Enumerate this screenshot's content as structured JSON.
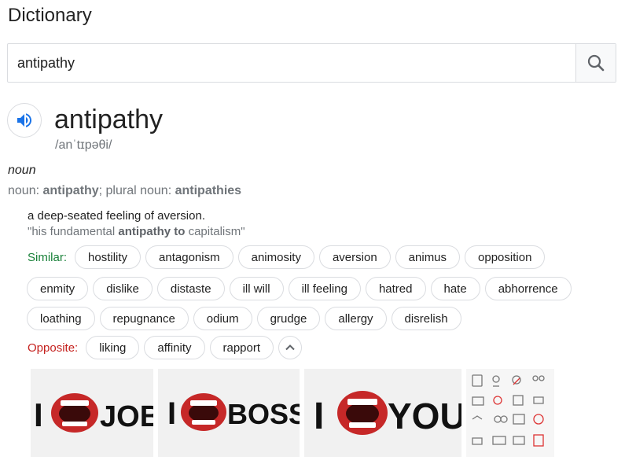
{
  "header": {
    "title": "Dictionary"
  },
  "search": {
    "value": "antipathy",
    "placeholder": ""
  },
  "entry": {
    "word": "antipathy",
    "phonetic": "/anˈtɪpəθi/",
    "part_of_speech": "noun",
    "forms": {
      "noun_label": "noun:",
      "noun": "antipathy",
      "separator": ";",
      "plural_label": "plural noun:",
      "plural": "antipathies"
    },
    "definition": "a deep-seated feeling of aversion.",
    "example": {
      "open": "\"his fundamental ",
      "highlight": "antipathy to",
      "close": " capitalism\""
    }
  },
  "similar": {
    "label": "Similar:",
    "words": [
      "hostility",
      "antagonism",
      "animosity",
      "aversion",
      "animus",
      "opposition",
      "enmity",
      "dislike",
      "distaste",
      "ill will",
      "ill feeling",
      "hatred",
      "hate",
      "abhorrence",
      "loathing",
      "repugnance",
      "odium",
      "grudge",
      "allergy",
      "disrelish"
    ]
  },
  "opposite": {
    "label": "Opposite:",
    "words": [
      "liking",
      "affinity",
      "rapport"
    ]
  },
  "images": [
    {
      "left": "I",
      "right": "JOB"
    },
    {
      "left": "I",
      "right": "BOSS"
    },
    {
      "left": "I",
      "right": "YOU"
    },
    {
      "icons": "antipathy icon set"
    }
  ],
  "colors": {
    "similar_label": "#188038",
    "opposite_label": "#c5221f",
    "speaker_blue": "#1a73e8"
  }
}
